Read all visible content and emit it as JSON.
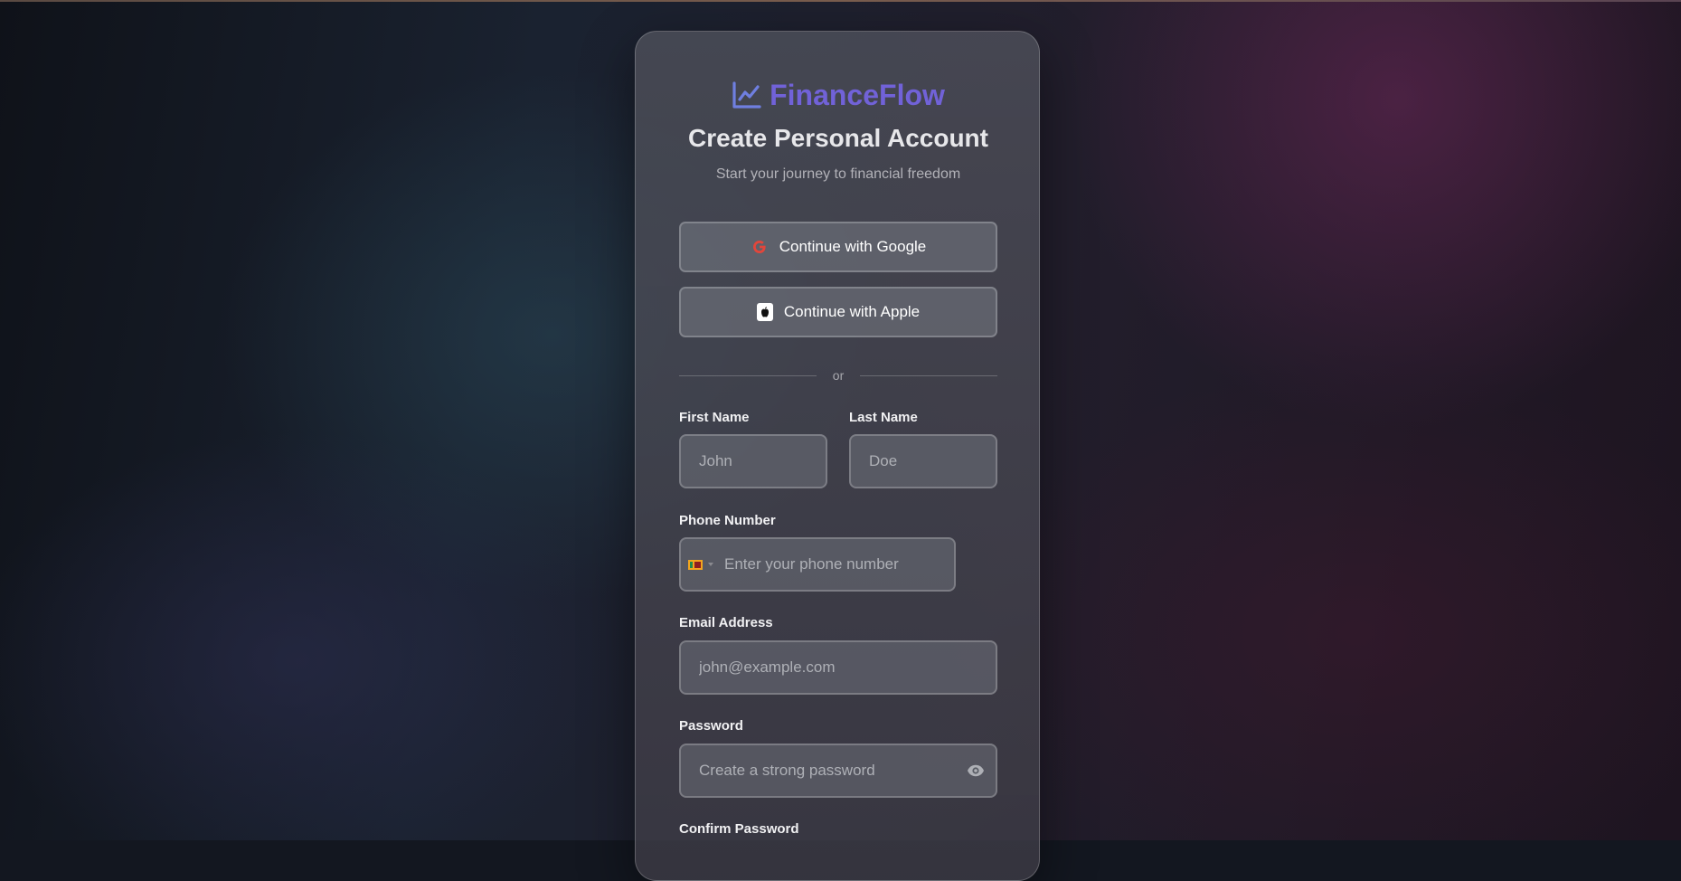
{
  "brand": {
    "name": "FinanceFlow",
    "icon": "line-chart-icon",
    "color": "#7162d8"
  },
  "header": {
    "title": "Create Personal Account",
    "subtitle": "Start your journey to financial freedom"
  },
  "sso": {
    "google_label": "Continue with Google",
    "google_icon": "google-icon",
    "apple_label": "Continue with Apple",
    "apple_icon": "apple-icon"
  },
  "divider": {
    "text": "or"
  },
  "form": {
    "first_name": {
      "label": "First Name",
      "placeholder": "John",
      "value": ""
    },
    "last_name": {
      "label": "Last Name",
      "placeholder": "Doe",
      "value": ""
    },
    "phone": {
      "label": "Phone Number",
      "placeholder": "Enter your phone number",
      "value": "",
      "country_flag": "flag-icon-sri-lanka"
    },
    "email": {
      "label": "Email Address",
      "placeholder": "john@example.com",
      "value": ""
    },
    "password": {
      "label": "Password",
      "placeholder": "Create a strong password",
      "value": "",
      "toggle_icon": "eye-icon"
    },
    "confirm_password": {
      "label": "Confirm Password"
    }
  }
}
